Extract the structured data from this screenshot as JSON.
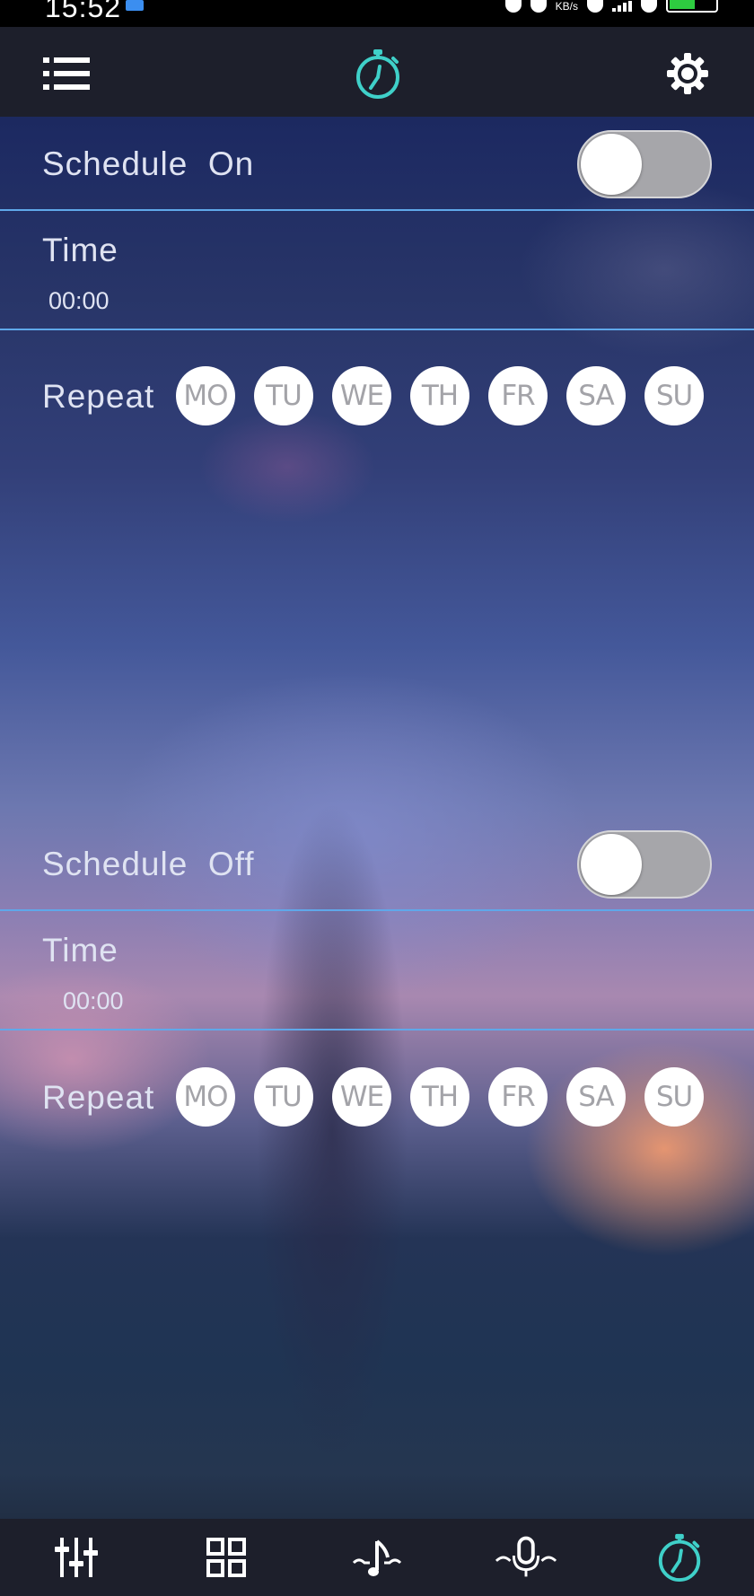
{
  "status_bar": {
    "time": "15:52",
    "network_speed_unit": "KB/s",
    "icons": [
      "app-notification-icon",
      "alarm-icon",
      "mute-icon",
      "hd-icon",
      "signal-icon",
      "wifi-icon",
      "battery-icon"
    ]
  },
  "header": {
    "left_icon": "menu-list-icon",
    "center_icon": "timer-icon",
    "right_icon": "gear-icon"
  },
  "schedule_on": {
    "label": "Schedule  On",
    "toggle_state": "off",
    "time_label": "Time",
    "time_value": "00:00",
    "repeat_label": "Repeat",
    "days": [
      "MO",
      "TU",
      "WE",
      "TH",
      "FR",
      "SA",
      "SU"
    ]
  },
  "schedule_off": {
    "label": "Schedule  Off",
    "toggle_state": "off",
    "time_label": "Time",
    "time_value": "00:00",
    "repeat_label": "Repeat",
    "days": [
      "MO",
      "TU",
      "WE",
      "TH",
      "FR",
      "SA",
      "SU"
    ]
  },
  "bottom_nav": {
    "items": [
      "equalizer-icon",
      "grid-icon",
      "music-note-wave-icon",
      "microphone-wave-icon",
      "timer-icon"
    ],
    "active": "timer-icon"
  },
  "colors": {
    "accent": "#3fd0c9",
    "divider": "#5fa8ea",
    "bar_background": "#1d1f2b"
  }
}
